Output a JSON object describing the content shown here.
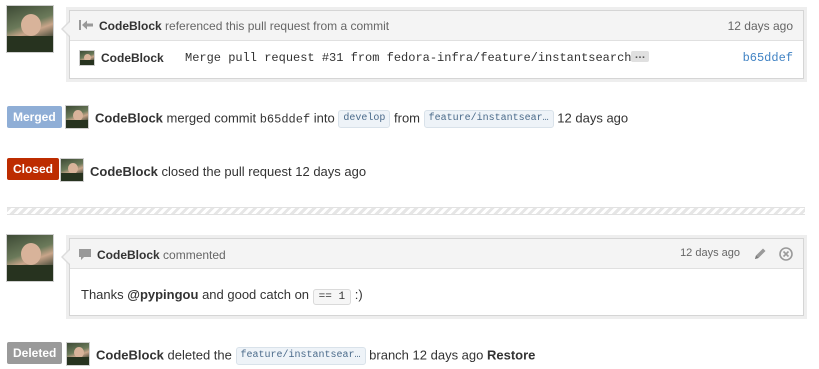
{
  "colors": {
    "merged": "#8faed6",
    "closed": "#bd2c00",
    "deleted": "#9a9a9a",
    "sha": "#4183c4"
  },
  "reference_event": {
    "user": "CodeBlock",
    "action": "referenced this pull request from a commit",
    "time": "12 days ago",
    "icon": "commit-reference-icon",
    "commit": {
      "user": "CodeBlock",
      "message": "Merge pull request #31 from fedora-infra/feature/instantsearch",
      "expand": "…",
      "sha": "b65ddef"
    }
  },
  "merged_event": {
    "badge": "Merged",
    "user": "CodeBlock",
    "text_merged": "merged commit",
    "sha": "b65ddef",
    "text_into": "into",
    "base_branch": "develop",
    "text_from": "from",
    "head_branch": "feature/instantsear…",
    "time": "12 days ago"
  },
  "closed_event": {
    "badge": "Closed",
    "user": "CodeBlock",
    "text": "closed the pull request",
    "time": "12 days ago"
  },
  "comment": {
    "user": "CodeBlock",
    "action": "commented",
    "time": "12 days ago",
    "body_prefix": "Thanks",
    "mention": "@pypingou",
    "body_middle": "and good catch on",
    "code": "== 1",
    "body_suffix": ":)"
  },
  "deleted_event": {
    "badge": "Deleted",
    "user": "CodeBlock",
    "text": "deleted the",
    "branch": "feature/instantsear…",
    "text_branch": "branch",
    "time": "12 days ago",
    "restore": "Restore"
  }
}
